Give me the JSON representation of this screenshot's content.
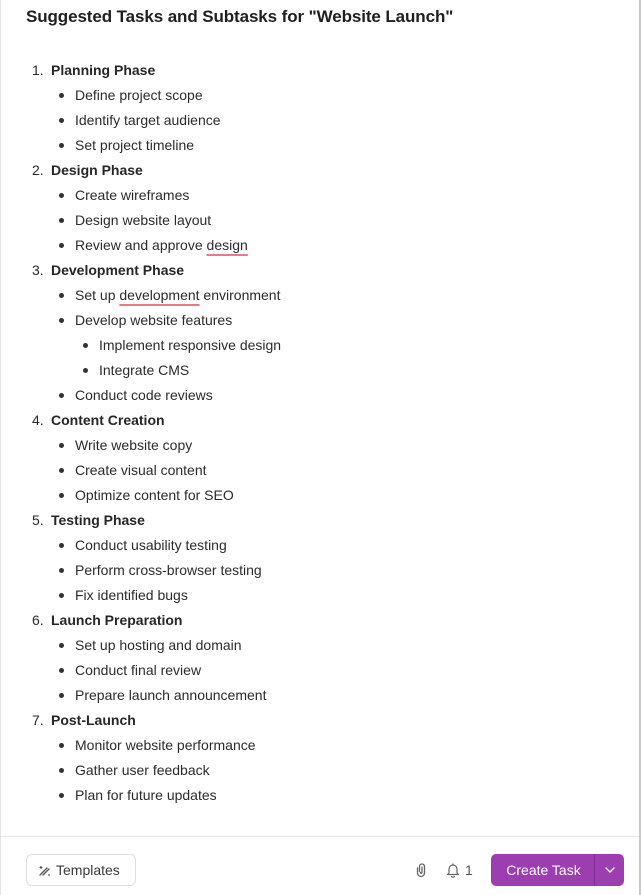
{
  "title": "Suggested Tasks and Subtasks for \"Website Launch\"",
  "phases": [
    {
      "number": "1.",
      "label": "Planning Phase",
      "tasks": [
        {
          "pre": "Define project scope",
          "flag": "",
          "post": ""
        },
        {
          "pre": "Identify target audience",
          "flag": "",
          "post": ""
        },
        {
          "pre": "Set project timeline",
          "flag": "",
          "post": ""
        }
      ]
    },
    {
      "number": "2.",
      "label": "Design Phase",
      "tasks": [
        {
          "pre": "Create wireframes",
          "flag": "",
          "post": ""
        },
        {
          "pre": "Design website layout",
          "flag": "",
          "post": ""
        },
        {
          "pre": "Review and approve ",
          "flag": "design",
          "post": ""
        }
      ]
    },
    {
      "number": "3.",
      "label": "Development Phase",
      "tasks": [
        {
          "pre": "Set up ",
          "flag": "development",
          "post": " environment"
        },
        {
          "pre": "Develop website features",
          "flag": "",
          "post": "",
          "subtasks": [
            "Implement responsive design",
            "Integrate CMS"
          ]
        },
        {
          "pre": "Conduct code reviews",
          "flag": "",
          "post": ""
        }
      ]
    },
    {
      "number": "4.",
      "label": "Content Creation",
      "tasks": [
        {
          "pre": "Write website copy",
          "flag": "",
          "post": ""
        },
        {
          "pre": "Create visual content",
          "flag": "",
          "post": ""
        },
        {
          "pre": "Optimize content for SEO",
          "flag": "",
          "post": ""
        }
      ]
    },
    {
      "number": "5.",
      "label": "Testing Phase",
      "tasks": [
        {
          "pre": "Conduct usability testing",
          "flag": "",
          "post": ""
        },
        {
          "pre": "Perform cross-browser testing",
          "flag": "",
          "post": ""
        },
        {
          "pre": "Fix identified bugs",
          "flag": "",
          "post": ""
        }
      ]
    },
    {
      "number": "6.",
      "label": "Launch Preparation",
      "tasks": [
        {
          "pre": "Set up hosting and domain",
          "flag": "",
          "post": ""
        },
        {
          "pre": "Conduct final review",
          "flag": "",
          "post": ""
        },
        {
          "pre": "Prepare launch announcement",
          "flag": "",
          "post": ""
        }
      ]
    },
    {
      "number": "7.",
      "label": "Post-Launch",
      "tasks": [
        {
          "pre": "Monitor website performance",
          "flag": "",
          "post": ""
        },
        {
          "pre": "Gather user feedback",
          "flag": "",
          "post": ""
        },
        {
          "pre": "Plan for future updates",
          "flag": "",
          "post": ""
        }
      ]
    }
  ],
  "footer": {
    "templates_label": "Templates",
    "templates_icon": "magic-wand-icon",
    "attach_icon": "paperclip-icon",
    "notification_icon": "bell-icon",
    "notification_count": "1",
    "create_label": "Create Task",
    "create_menu_icon": "chevron-down-icon"
  },
  "colors": {
    "accent": "#9c3db0",
    "spellcheck_underline": "#e8788e"
  }
}
